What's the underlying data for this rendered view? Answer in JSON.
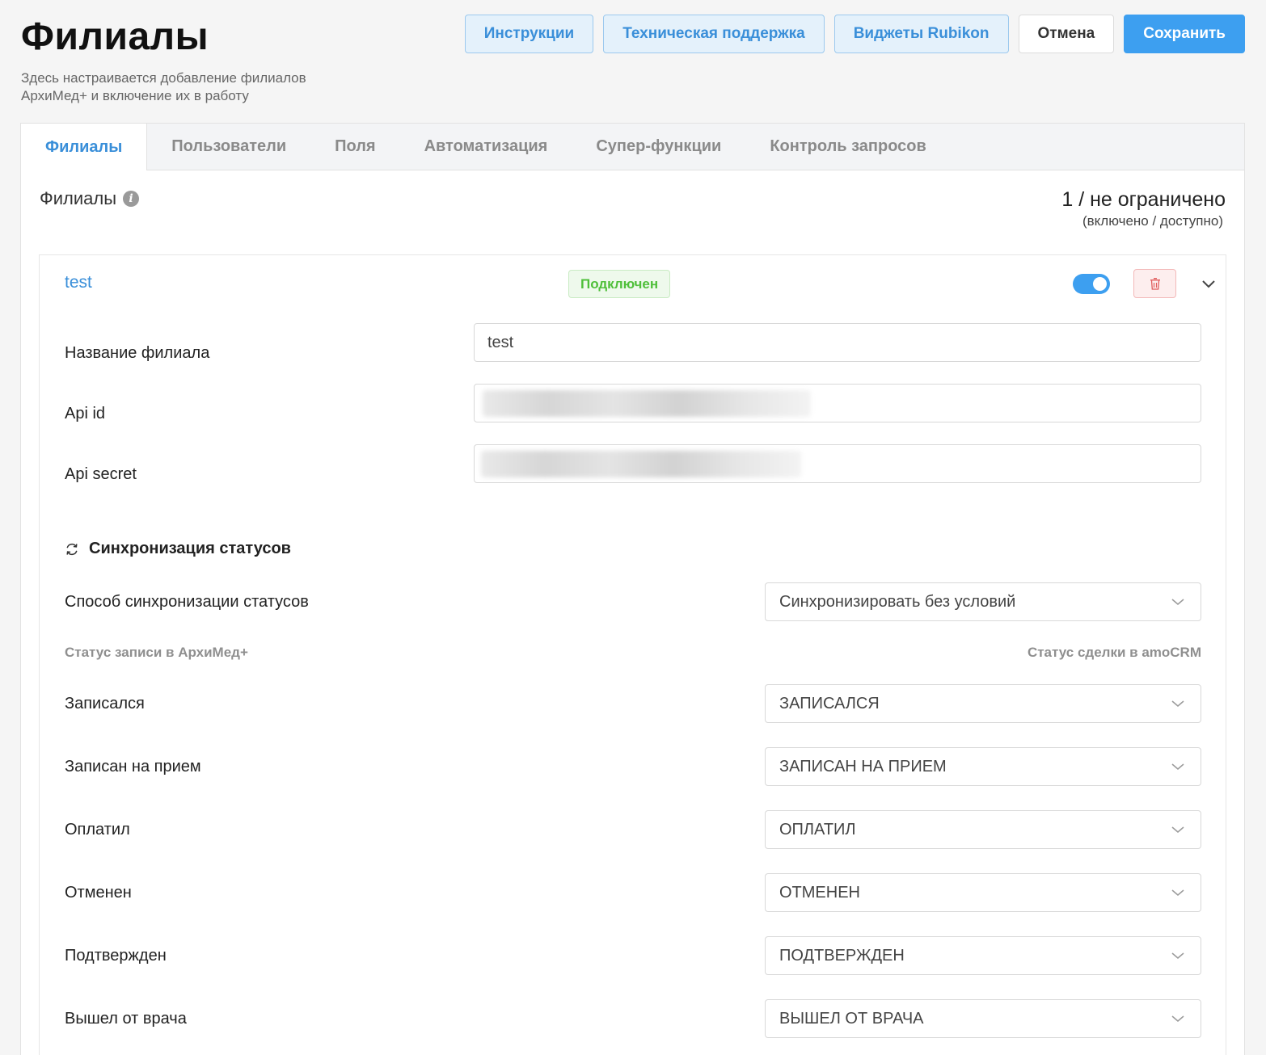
{
  "header": {
    "title": "Филиалы",
    "subtitle": "Здесь настраивается добавление филиалов АрхиМед+ и включение их в работу",
    "buttons": {
      "instructions": "Инструкции",
      "support": "Техническая поддержка",
      "widgets": "Виджеты Rubikon",
      "cancel": "Отмена",
      "save": "Сохранить"
    }
  },
  "tabs": [
    "Филиалы",
    "Пользователи",
    "Поля",
    "Автоматизация",
    "Супер-функции",
    "Контроль запросов"
  ],
  "section": {
    "title": "Филиалы",
    "limit_count": "1 / не ограничено",
    "limit_caption": "(включено / доступно)"
  },
  "branch": {
    "name": "test",
    "status": "Подключен",
    "enabled": true,
    "fields": {
      "name_label": "Название филиала",
      "name_value": "test",
      "api_id_label": "Api id",
      "api_secret_label": "Api secret"
    },
    "sync": {
      "title": "Синхронизация статусов",
      "method_label": "Способ синхронизации статусов",
      "method_value": "Синхронизировать без условий",
      "col_left": "Статус записи в АрхиМед+",
      "col_right": "Статус сделки в amoCRM",
      "rows": [
        {
          "label": "Записался",
          "value": "ЗАПИСАЛСЯ"
        },
        {
          "label": "Записан на прием",
          "value": "ЗАПИСАН НА ПРИЕМ"
        },
        {
          "label": "Оплатил",
          "value": "ОПЛАТИЛ"
        },
        {
          "label": "Отменен",
          "value": "ОТМЕНЕН"
        },
        {
          "label": "Подтвержден",
          "value": "ПОДТВЕРЖДЕН"
        },
        {
          "label": "Вышел от врача",
          "value": "ВЫШЕЛ ОТ ВРАЧА"
        }
      ]
    }
  },
  "colors": {
    "accent": "#3d9ff0",
    "link": "#3a8fd9",
    "success": "#4fbf3a",
    "danger": "#e05a5a"
  },
  "icons": [
    "info-icon",
    "sync-icon",
    "trash-icon",
    "chevron-down-icon"
  ]
}
